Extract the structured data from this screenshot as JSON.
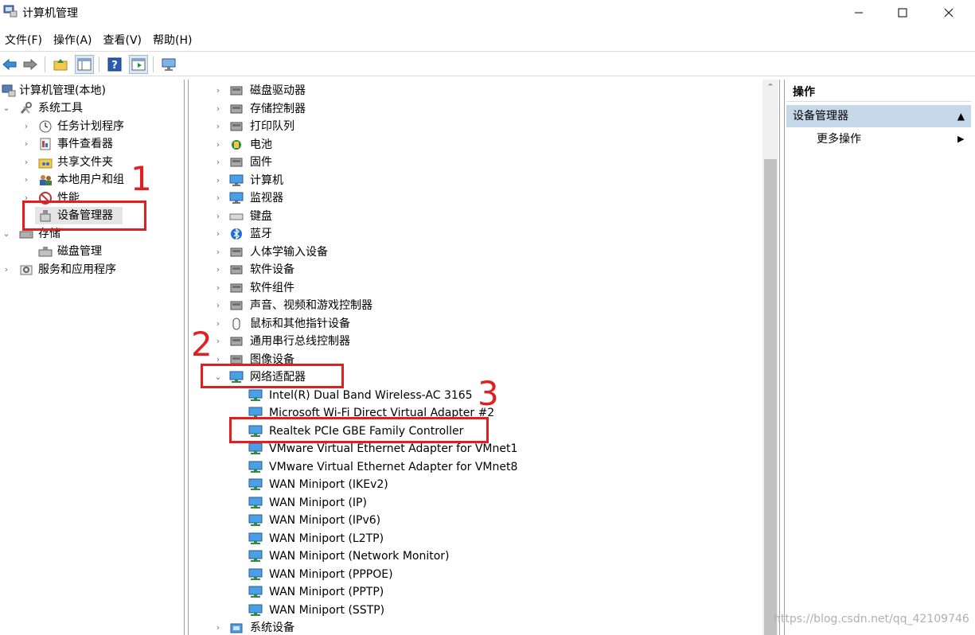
{
  "window": {
    "title": "计算机管理",
    "controls": [
      "minimize",
      "maximize",
      "close"
    ]
  },
  "menu": [
    "文件(F)",
    "操作(A)",
    "查看(V)",
    "帮助(H)"
  ],
  "toolbar": [
    "back-icon",
    "forward-icon",
    "up-folder-icon",
    "show-hide-tree-icon",
    "help-icon",
    "properties-icon",
    "monitor-icon"
  ],
  "left_tree": {
    "root": "计算机管理(本地)",
    "system_tools": "系统工具",
    "task_scheduler": "任务计划程序",
    "event_viewer": "事件查看器",
    "shared_folders": "共享文件夹",
    "local_users": "本地用户和组",
    "performance": "性能",
    "device_manager": "设备管理器",
    "storage": "存储",
    "disk_management": "磁盘管理",
    "services_apps": "服务和应用程序"
  },
  "device_tree": {
    "categories": [
      "磁盘驱动器",
      "存储控制器",
      "打印队列",
      "电池",
      "固件",
      "计算机",
      "监视器",
      "键盘",
      "蓝牙",
      "人体学输入设备",
      "软件设备",
      "软件组件",
      "声音、视频和游戏控制器",
      "鼠标和其他指针设备",
      "通用串行总线控制器",
      "图像设备"
    ],
    "network_adapters": "网络适配器",
    "adapters": [
      "Intel(R) Dual Band Wireless-AC 3165",
      "Microsoft Wi-Fi Direct Virtual Adapter #2",
      "Realtek PCIe GBE Family Controller",
      "VMware Virtual Ethernet Adapter for VMnet1",
      "VMware Virtual Ethernet Adapter for VMnet8",
      "WAN Miniport (IKEv2)",
      "WAN Miniport (IP)",
      "WAN Miniport (IPv6)",
      "WAN Miniport (L2TP)",
      "WAN Miniport (Network Monitor)",
      "WAN Miniport (PPPOE)",
      "WAN Miniport (PPTP)",
      "WAN Miniport (SSTP)"
    ],
    "system_devices": "系统设备"
  },
  "actions": {
    "header": "操作",
    "section": "设备管理器",
    "more": "更多操作"
  },
  "annotations": {
    "n1": "1",
    "n2": "2",
    "n3": "3",
    "color": "#e02020"
  },
  "watermark": "https://blog.csdn.net/qq_42109746"
}
